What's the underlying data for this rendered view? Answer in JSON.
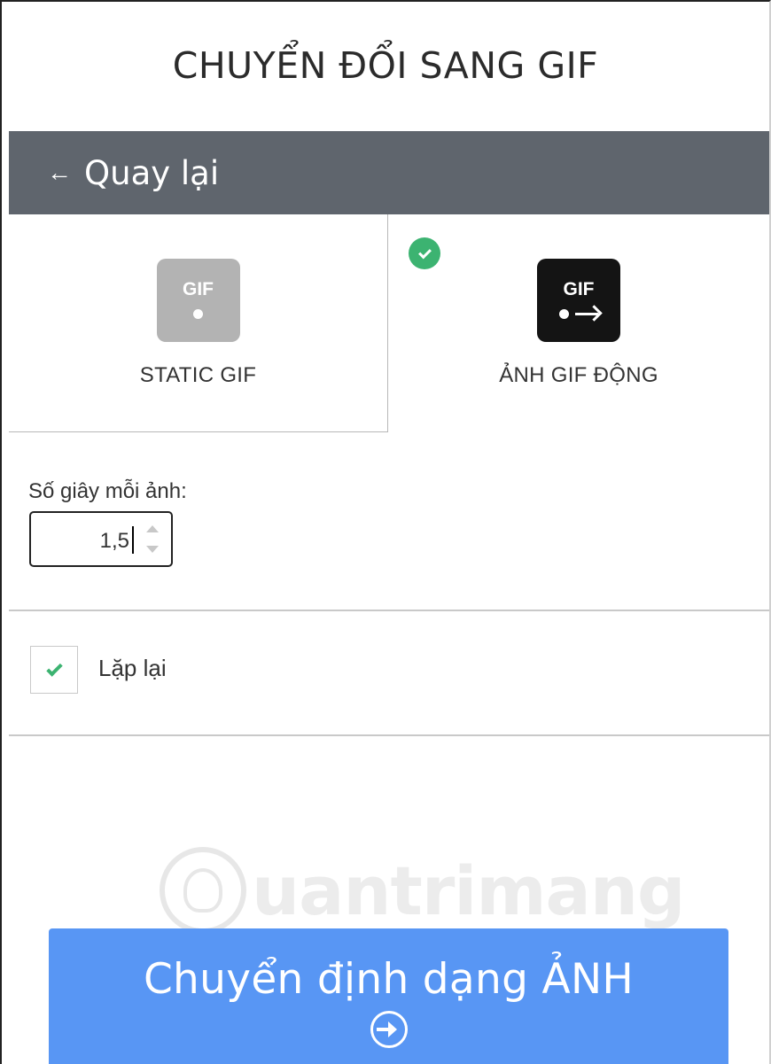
{
  "header": {
    "title": "CHUYỂN ĐỔI SANG GIF"
  },
  "nav": {
    "back_arrow": "←",
    "back_label": "Quay lại"
  },
  "modes": [
    {
      "icon": "static-gif-icon",
      "icon_text": "GIF",
      "label": "STATIC GIF",
      "selected": false
    },
    {
      "icon": "animated-gif-icon",
      "icon_text": "GIF",
      "label": "ẢNH GIF ĐỘNG",
      "selected": true
    }
  ],
  "settings": {
    "seconds_label": "Số giây mỗi ảnh:",
    "seconds_value": "1,5",
    "loop_label": "Lặp lại",
    "loop_checked": true
  },
  "watermark": {
    "text": "uantrimang",
    "icon": "lightbulb-logo-icon"
  },
  "action": {
    "convert_label": "Chuyển định dạng ẢNH",
    "icon": "arrow-right-circle-icon"
  },
  "colors": {
    "nav_bar": "#5f656d",
    "accent_green": "#3cb371",
    "button_blue": "#5896f4",
    "static_icon_bg": "#b3b3b3",
    "animated_icon_bg": "#141414"
  }
}
